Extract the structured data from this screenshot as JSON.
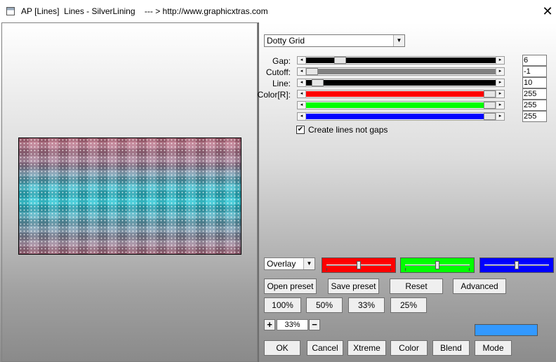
{
  "window": {
    "title": "AP [Lines]  Lines - SilverLining    --- > http://www.graphicxtras.com",
    "close_glyph": "✕"
  },
  "effect": {
    "selected": "Dotty Grid",
    "arrow_glyph": "▼"
  },
  "sliders": {
    "gap": {
      "label": "Gap:",
      "value": "6",
      "fraction": 0.16,
      "color": "#000000"
    },
    "cutoff": {
      "label": "Cutoff:",
      "value": "-1",
      "fraction": 0.0,
      "color": "#808080"
    },
    "line": {
      "label": "Line:",
      "value": "10",
      "fraction": 0.03,
      "color": "#000000"
    },
    "red": {
      "label": "Color[R]:",
      "value": "255",
      "fraction": 1.0,
      "color": "#ff0000"
    },
    "green": {
      "label": "",
      "value": "255",
      "fraction": 1.0,
      "color": "#00ff00"
    },
    "blue": {
      "label": "",
      "value": "255",
      "fraction": 1.0,
      "color": "#0000ff"
    },
    "arrow_left": "◂",
    "arrow_right": "▸"
  },
  "options": {
    "create_lines_not_gaps": {
      "label": "Create lines not gaps",
      "checked": true,
      "check_glyph": "✔"
    }
  },
  "blend": {
    "mode": "Overlay",
    "color_sliders": [
      {
        "color": "#ff0000",
        "fraction": 0.5
      },
      {
        "color": "#00ff00",
        "fraction": 0.5
      },
      {
        "color": "#0000ff",
        "fraction": 0.5
      }
    ]
  },
  "buttons": {
    "open_preset": "Open preset",
    "save_preset": "Save preset",
    "reset": "Reset",
    "advanced": "Advanced",
    "zoom_100": "100%",
    "zoom_50": "50%",
    "zoom_33": "33%",
    "zoom_25": "25%",
    "ok": "OK",
    "cancel": "Cancel",
    "xtreme": "Xtreme",
    "color": "Color",
    "blend": "Blend",
    "mode": "Mode"
  },
  "zoom": {
    "plus": "+",
    "minus": "−",
    "value": "33%"
  },
  "swatch_color": "#3399ff"
}
